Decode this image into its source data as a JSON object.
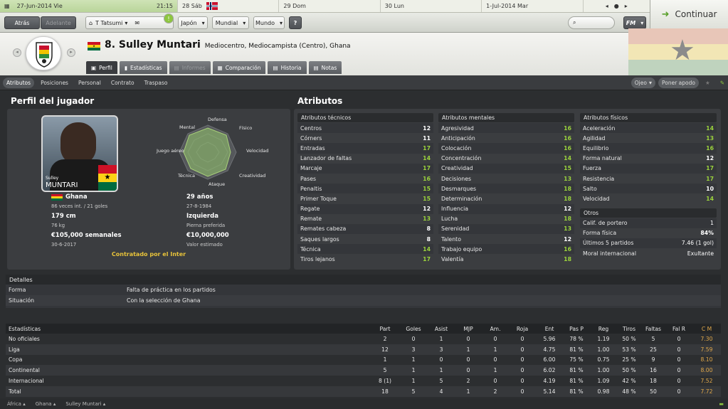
{
  "calendar": {
    "today_date": "27-Jun-2014 Vie",
    "time": "21:15",
    "days": [
      "28 Sáb",
      "29 Dom",
      "30 Lun",
      "1-Jul-2014 Mar"
    ]
  },
  "toolbar": {
    "back": "Atrás",
    "forward": "Adelante",
    "manager": "T Tatsumi",
    "japan": "Japón",
    "world_cup": "Mundial",
    "world": "Mundo",
    "help": "?",
    "continue": "Continuar",
    "fm_menu": "FM"
  },
  "player": {
    "number_name": "8. Sulley Muntari",
    "position": "Mediocentro, Mediocampista (Centro), Ghana",
    "card_first": "Sulley",
    "card_last": "MUNTARI"
  },
  "tabs": [
    "Perfil",
    "Estadísticas",
    "Informes",
    "Comparación",
    "Historia",
    "Notas"
  ],
  "subnav": [
    "Atributos",
    "Posiciones",
    "Personal",
    "Contrato",
    "Traspaso"
  ],
  "subnav_right": {
    "scout": "Ojeo",
    "nickname": "Poner apodo"
  },
  "profile": {
    "title": "Perfil del jugador",
    "radar_labels": [
      "Defensa",
      "Físico",
      "Velocidad",
      "Creatividad",
      "Ataque",
      "Técnica",
      "Juego aéreo",
      "Mental"
    ],
    "nation": "Ghana",
    "caps": "86 veces int. / 21 goles",
    "age": "29 años",
    "dob": "27-8-1984",
    "height": "179 cm",
    "weight": "76 kg",
    "foot": "Izquierda",
    "foot_label": "Pierna preferida",
    "wage": "€105,000 semanales",
    "contract_end": "30-6-2017",
    "value": "€10,000,000",
    "value_label": "Valor estimado",
    "status": "Contratado por el Inter"
  },
  "attributes": {
    "title": "Atributos",
    "technical_title": "Atributos técnicos",
    "technical": [
      [
        "Centros",
        "12"
      ],
      [
        "Córners",
        "11"
      ],
      [
        "Entradas",
        "17"
      ],
      [
        "Lanzador de faltas",
        "14"
      ],
      [
        "Marcaje",
        "17"
      ],
      [
        "Pases",
        "16"
      ],
      [
        "Penaltis",
        "15"
      ],
      [
        "Primer Toque",
        "15"
      ],
      [
        "Regate",
        "12"
      ],
      [
        "Remate",
        "13"
      ],
      [
        "Remates cabeza",
        "8"
      ],
      [
        "Saques largos",
        "8"
      ],
      [
        "Técnica",
        "14"
      ],
      [
        "Tiros lejanos",
        "17"
      ]
    ],
    "mental_title": "Atributos mentales",
    "mental": [
      [
        "Agresividad",
        "16"
      ],
      [
        "Anticipación",
        "16"
      ],
      [
        "Colocación",
        "16"
      ],
      [
        "Concentración",
        "14"
      ],
      [
        "Creatividad",
        "15"
      ],
      [
        "Decisiones",
        "13"
      ],
      [
        "Desmarques",
        "18"
      ],
      [
        "Determinación",
        "18"
      ],
      [
        "Influencia",
        "12"
      ],
      [
        "Lucha",
        "18"
      ],
      [
        "Serenidad",
        "13"
      ],
      [
        "Talento",
        "12"
      ],
      [
        "Trabajo equipo",
        "16"
      ],
      [
        "Valentía",
        "18"
      ]
    ],
    "physical_title": "Atributos físicos",
    "physical": [
      [
        "Aceleración",
        "14"
      ],
      [
        "Agilidad",
        "13"
      ],
      [
        "Equilibrio",
        "16"
      ],
      [
        "Forma natural",
        "12"
      ],
      [
        "Fuerza",
        "17"
      ],
      [
        "Resistencia",
        "17"
      ],
      [
        "Salto",
        "10"
      ],
      [
        "Velocidad",
        "14"
      ]
    ],
    "other_title": "Otros",
    "other": [
      [
        "Calif. de portero",
        "1"
      ],
      [
        "Forma física",
        "84%"
      ],
      [
        "Últimos 5 partidos",
        "7.46 (1 gol)"
      ],
      [
        "Moral internacional",
        "Exultante"
      ]
    ]
  },
  "details": {
    "title": "Detalles",
    "rows": [
      [
        "Forma",
        "Falta de práctica en los partidos"
      ],
      [
        "Situación",
        "Con la selección de Ghana"
      ]
    ]
  },
  "stats": {
    "headers": [
      "Estadísticas",
      "Part",
      "Goles",
      "Asist",
      "MJP",
      "Am.",
      "Roja",
      "Ent",
      "Pas P",
      "Reg",
      "Tiros",
      "Faltas",
      "Fal R",
      "C M"
    ],
    "rows": [
      [
        "No oficiales",
        "2",
        "0",
        "1",
        "0",
        "0",
        "0",
        "5.96",
        "78 %",
        "1.19",
        "50 %",
        "5",
        "0",
        "7.30"
      ],
      [
        "Liga",
        "12",
        "3",
        "3",
        "1",
        "1",
        "0",
        "4.75",
        "81 %",
        "1.00",
        "53 %",
        "25",
        "0",
        "7.59"
      ],
      [
        "Copa",
        "1",
        "1",
        "0",
        "0",
        "0",
        "0",
        "6.00",
        "75 %",
        "0.75",
        "25 %",
        "9",
        "0",
        "8.10"
      ],
      [
        "Continental",
        "5",
        "1",
        "1",
        "0",
        "1",
        "0",
        "6.02",
        "81 %",
        "1.00",
        "50 %",
        "16",
        "0",
        "8.00"
      ],
      [
        "Internacional",
        "8 (1)",
        "1",
        "5",
        "2",
        "0",
        "0",
        "4.19",
        "81 %",
        "1.09",
        "42 %",
        "18",
        "0",
        "7.52"
      ],
      [
        "Total",
        "18",
        "5",
        "4",
        "1",
        "2",
        "0",
        "5.14",
        "81 %",
        "0.98",
        "48 %",
        "50",
        "0",
        "7.72"
      ]
    ]
  },
  "breadcrumb": [
    "África",
    "Ghana",
    "Sulley Muntari"
  ],
  "colors": {
    "accent_green": "#9bd33c",
    "gold": "#e8c33a",
    "cm_orange": "#e0a84a"
  }
}
